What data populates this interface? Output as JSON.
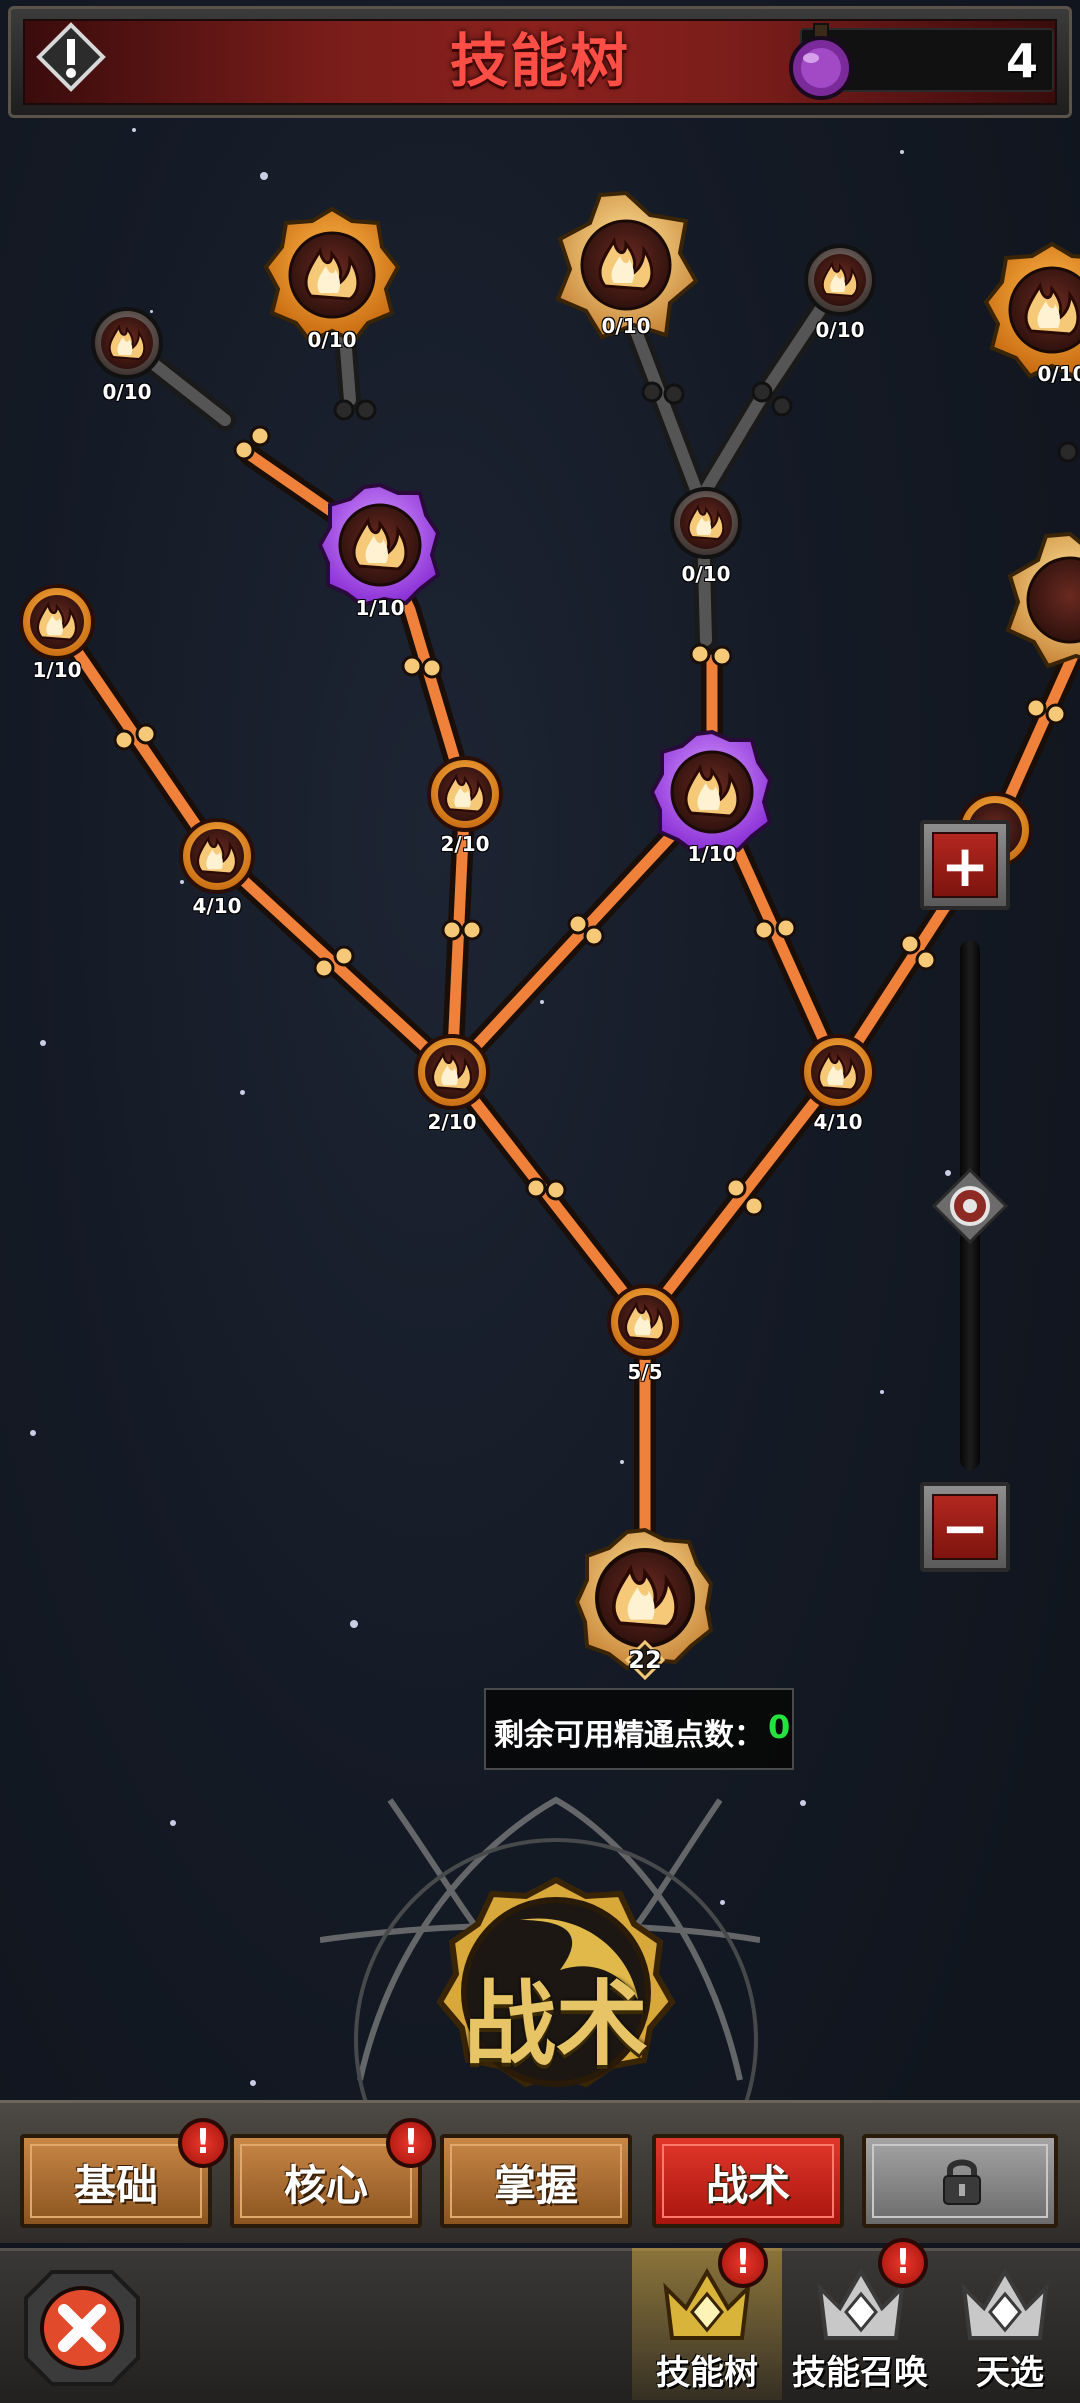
{
  "header": {
    "title": "技能树",
    "counter": "4"
  },
  "tree": {
    "nodes": [
      {
        "id": "root",
        "label": "22"
      },
      {
        "id": "n_trunk",
        "label": "5/5"
      },
      {
        "id": "n_left_fork",
        "label": "2/10"
      },
      {
        "id": "n_right_fork",
        "label": "4/10"
      },
      {
        "id": "n_left_branch",
        "label": "4/10"
      },
      {
        "id": "n_far_left",
        "label": "1/10"
      },
      {
        "id": "n_mid_left",
        "label": "2/10"
      },
      {
        "id": "n_purple_left",
        "label": "1/10"
      },
      {
        "id": "n_top_left_small",
        "label": "0/10"
      },
      {
        "id": "n_top_left_gold",
        "label": "0/10"
      },
      {
        "id": "n_purple_right",
        "label": "1/10"
      },
      {
        "id": "n_mid_dark",
        "label": "0/10"
      },
      {
        "id": "n_top_gold",
        "label": "0/10"
      },
      {
        "id": "n_top_right_small",
        "label": "0/10"
      },
      {
        "id": "n_edge_right",
        "label": "0/10"
      }
    ]
  },
  "points": {
    "label": "剩余可用精通点数：",
    "value": "0"
  },
  "emblem": {
    "text": "战术"
  },
  "tabs": [
    {
      "label": "基础",
      "badge": "!"
    },
    {
      "label": "核心",
      "badge": "!"
    },
    {
      "label": "掌握",
      "badge": ""
    },
    {
      "label": "战术",
      "badge": ""
    },
    {
      "label": "",
      "badge": ""
    }
  ],
  "nav": [
    {
      "label": "技能树",
      "badge": "!"
    },
    {
      "label": "技能召唤",
      "badge": "!"
    },
    {
      "label": "天选",
      "badge": ""
    }
  ],
  "zoom": {
    "plus": "+",
    "minus": "−"
  },
  "colors": {
    "active_path": "#f0813a",
    "inactive_path": "#4a4a4a",
    "accent_red": "#ff4e46",
    "points_green": "#25e33d"
  }
}
